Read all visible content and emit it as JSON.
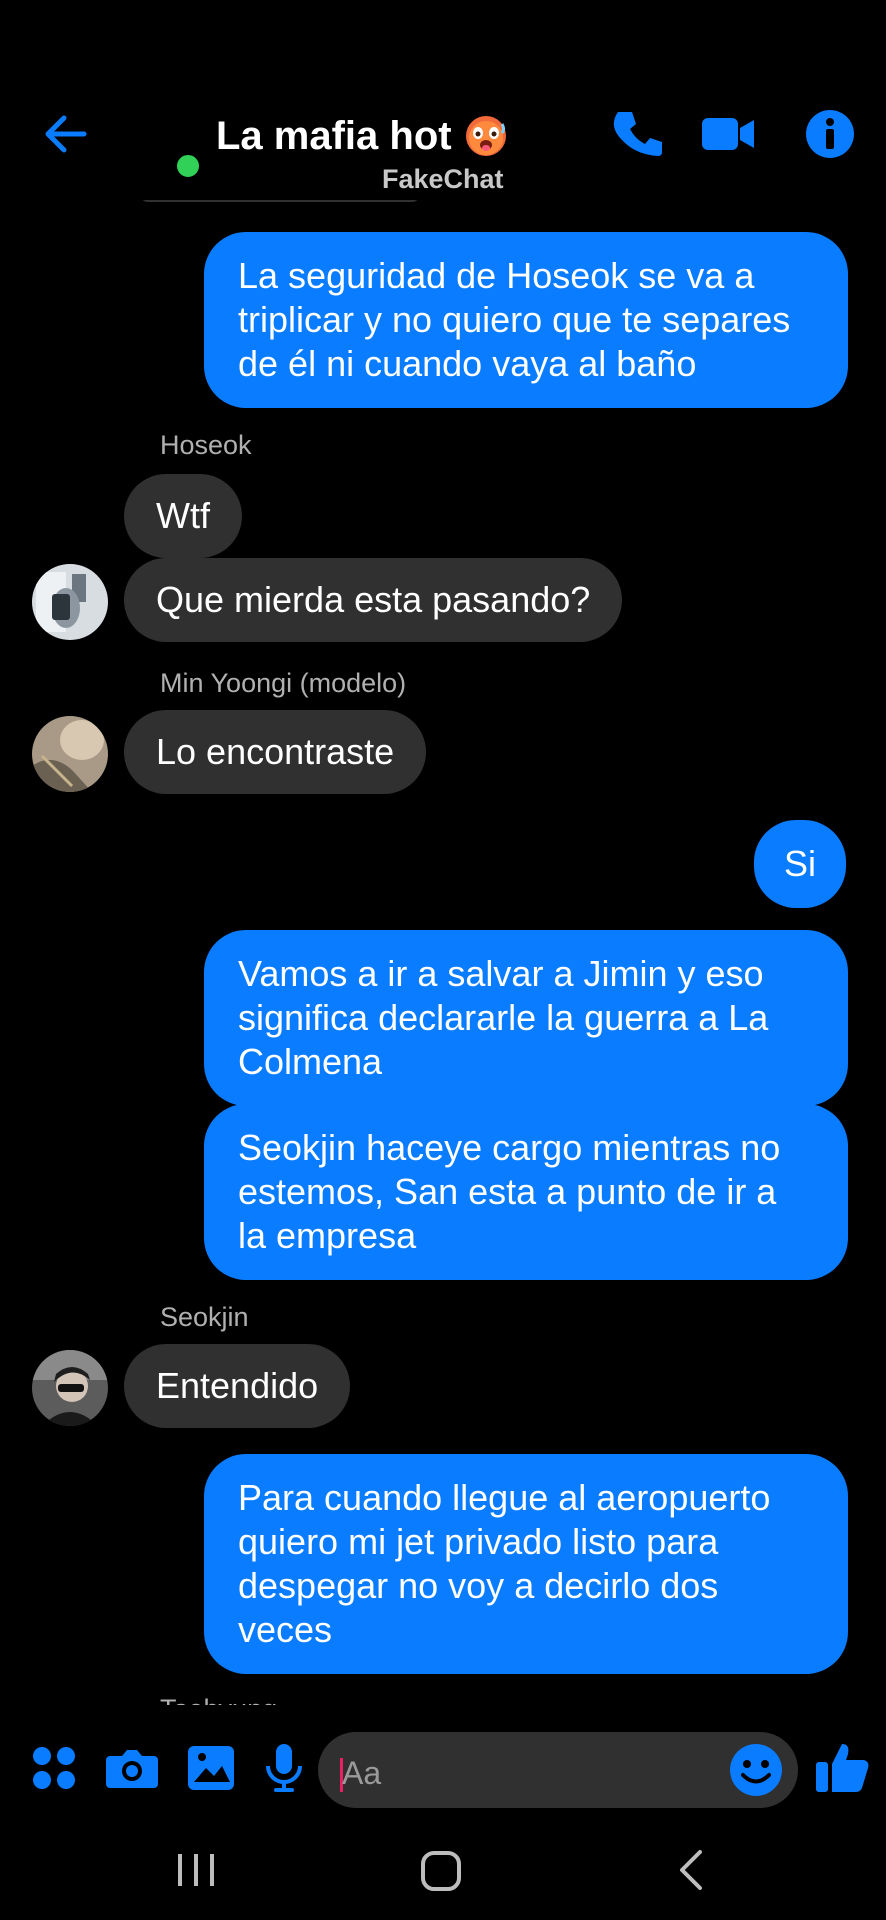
{
  "header": {
    "title": "La mafia hot",
    "title_emoji": "hot-face-emoji",
    "watermark": "FakeChat",
    "icons": [
      "back-arrow-icon",
      "phone-icon",
      "video-camera-icon",
      "info-icon"
    ]
  },
  "messages": [
    {
      "type": "out",
      "text": "La seguridad de Hoseok se va a triplicar y no quiero que te separes de él ni cuando vaya al baño"
    },
    {
      "type": "sender",
      "text": "Hoseok"
    },
    {
      "type": "in",
      "text": "Wtf"
    },
    {
      "type": "in",
      "text": "Que mierda esta pasando?"
    },
    {
      "type": "sender",
      "text": "Min Yoongi (modelo)"
    },
    {
      "type": "in",
      "text": "Lo encontraste"
    },
    {
      "type": "out",
      "text": "Si"
    },
    {
      "type": "out",
      "text": "Vamos a ir a salvar a Jimin y eso significa declararle la guerra a La Colmena"
    },
    {
      "type": "out",
      "text": "Seokjin haceye cargo mientras no estemos, San esta a punto de ir a la empresa"
    },
    {
      "type": "sender",
      "text": "Seokjin"
    },
    {
      "type": "in",
      "text": "Entendido"
    },
    {
      "type": "out",
      "text": "Para cuando llegue al aeropuerto quiero mi jet privado listo para despegar no voy a decirlo dos veces"
    },
    {
      "type": "sender",
      "text": "Taehyung"
    }
  ],
  "composer": {
    "placeholder": "Aa",
    "value": "",
    "icons": [
      "apps-icon",
      "camera-icon",
      "gallery-icon",
      "microphone-icon",
      "emoji-icon",
      "thumbs-up-icon"
    ]
  },
  "navbar": {
    "icons": [
      "recent-apps-icon",
      "home-icon",
      "back-icon"
    ]
  },
  "colors": {
    "accent": "#0a7cff",
    "incoming_bubble": "#303030",
    "online": "#31d158",
    "background": "#000000"
  }
}
